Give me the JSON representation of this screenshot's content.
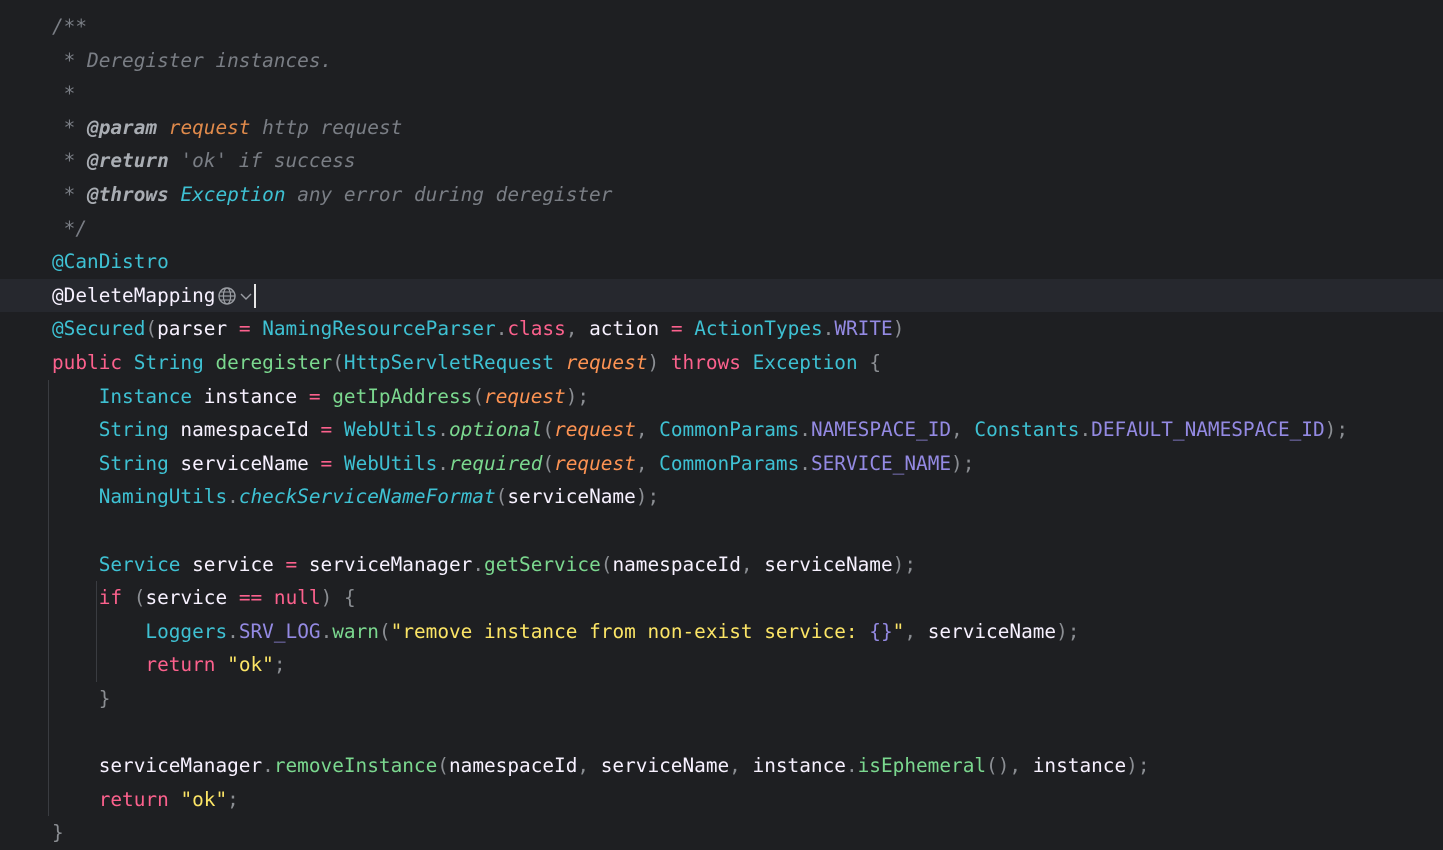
{
  "editor": {
    "language": "Java",
    "lines": [
      [
        [
          "comment",
          "/**"
        ]
      ],
      [
        [
          "comment",
          " * Deregister instances."
        ]
      ],
      [
        [
          "comment",
          " *"
        ]
      ],
      [
        [
          "comment",
          " * "
        ],
        [
          "doctag",
          "@param"
        ],
        [
          "comment",
          " "
        ],
        [
          "docparam",
          "request"
        ],
        [
          "comment",
          " http request"
        ]
      ],
      [
        [
          "comment",
          " * "
        ],
        [
          "doctag",
          "@return"
        ],
        [
          "comment",
          " 'ok' if success"
        ]
      ],
      [
        [
          "comment",
          " * "
        ],
        [
          "doctag",
          "@throws"
        ],
        [
          "comment",
          " "
        ],
        [
          "doccls",
          "Exception"
        ],
        [
          "comment",
          " any error during deregister"
        ]
      ],
      [
        [
          "comment",
          " */"
        ]
      ],
      [
        [
          "annotation",
          "@CanDistro"
        ]
      ],
      [
        [
          "plain",
          "@DeleteMapping"
        ]
      ],
      [
        [
          "annotation",
          "@Secured"
        ],
        [
          "punc",
          "("
        ],
        [
          "plain",
          "parser "
        ],
        [
          "op",
          "="
        ],
        [
          "plain",
          " "
        ],
        [
          "type",
          "NamingResourceParser"
        ],
        [
          "punc",
          "."
        ],
        [
          "kw",
          "class"
        ],
        [
          "punc",
          ", "
        ],
        [
          "plain",
          "action "
        ],
        [
          "op",
          "="
        ],
        [
          "plain",
          " "
        ],
        [
          "type",
          "ActionTypes"
        ],
        [
          "punc",
          "."
        ],
        [
          "const",
          "WRITE"
        ],
        [
          "punc",
          ")"
        ]
      ],
      [
        [
          "kw",
          "public"
        ],
        [
          "plain",
          " "
        ],
        [
          "type",
          "String"
        ],
        [
          "plain",
          " "
        ],
        [
          "fn",
          "deregister"
        ],
        [
          "punc",
          "("
        ],
        [
          "type",
          "HttpServletRequest"
        ],
        [
          "plain",
          " "
        ],
        [
          "param",
          "request"
        ],
        [
          "punc",
          ")"
        ],
        [
          "plain",
          " "
        ],
        [
          "kw",
          "throws"
        ],
        [
          "plain",
          " "
        ],
        [
          "type",
          "Exception"
        ],
        [
          "plain",
          " "
        ],
        [
          "punc",
          "{"
        ]
      ],
      [
        [
          "plain",
          "    "
        ],
        [
          "type",
          "Instance"
        ],
        [
          "plain",
          " instance "
        ],
        [
          "op",
          "="
        ],
        [
          "plain",
          " "
        ],
        [
          "fn",
          "getIpAddress"
        ],
        [
          "punc",
          "("
        ],
        [
          "param",
          "request"
        ],
        [
          "punc",
          ");"
        ]
      ],
      [
        [
          "plain",
          "    "
        ],
        [
          "type",
          "String"
        ],
        [
          "plain",
          " namespaceId "
        ],
        [
          "op",
          "="
        ],
        [
          "plain",
          " "
        ],
        [
          "type",
          "WebUtils"
        ],
        [
          "punc",
          "."
        ],
        [
          "fni",
          "optional"
        ],
        [
          "punc",
          "("
        ],
        [
          "param",
          "request"
        ],
        [
          "punc",
          ", "
        ],
        [
          "type",
          "CommonParams"
        ],
        [
          "punc",
          "."
        ],
        [
          "const",
          "NAMESPACE_ID"
        ],
        [
          "punc",
          ", "
        ],
        [
          "type",
          "Constants"
        ],
        [
          "punc",
          "."
        ],
        [
          "const",
          "DEFAULT_NAMESPACE_ID"
        ],
        [
          "punc",
          ");"
        ]
      ],
      [
        [
          "plain",
          "    "
        ],
        [
          "type",
          "String"
        ],
        [
          "plain",
          " serviceName "
        ],
        [
          "op",
          "="
        ],
        [
          "plain",
          " "
        ],
        [
          "type",
          "WebUtils"
        ],
        [
          "punc",
          "."
        ],
        [
          "fni",
          "required"
        ],
        [
          "punc",
          "("
        ],
        [
          "param",
          "request"
        ],
        [
          "punc",
          ", "
        ],
        [
          "type",
          "CommonParams"
        ],
        [
          "punc",
          "."
        ],
        [
          "const",
          "SERVICE_NAME"
        ],
        [
          "punc",
          ");"
        ]
      ],
      [
        [
          "plain",
          "    "
        ],
        [
          "type",
          "NamingUtils"
        ],
        [
          "punc",
          "."
        ],
        [
          "fnsi",
          "checkServiceNameFormat"
        ],
        [
          "punc",
          "("
        ],
        [
          "plain",
          "serviceName"
        ],
        [
          "punc",
          ");"
        ]
      ],
      [],
      [
        [
          "plain",
          "    "
        ],
        [
          "type",
          "Service"
        ],
        [
          "plain",
          " service "
        ],
        [
          "op",
          "="
        ],
        [
          "plain",
          " serviceManager"
        ],
        [
          "punc",
          "."
        ],
        [
          "fn",
          "getService"
        ],
        [
          "punc",
          "("
        ],
        [
          "plain",
          "namespaceId"
        ],
        [
          "punc",
          ", "
        ],
        [
          "plain",
          "serviceName"
        ],
        [
          "punc",
          ");"
        ]
      ],
      [
        [
          "plain",
          "    "
        ],
        [
          "kw",
          "if"
        ],
        [
          "plain",
          " "
        ],
        [
          "punc",
          "("
        ],
        [
          "plain",
          "service "
        ],
        [
          "op",
          "=="
        ],
        [
          "plain",
          " "
        ],
        [
          "kw",
          "null"
        ],
        [
          "punc",
          ")"
        ],
        [
          "plain",
          " "
        ],
        [
          "punc",
          "{"
        ]
      ],
      [
        [
          "plain",
          "        "
        ],
        [
          "type",
          "Loggers"
        ],
        [
          "punc",
          "."
        ],
        [
          "const",
          "SRV_LOG"
        ],
        [
          "punc",
          "."
        ],
        [
          "fn",
          "warn"
        ],
        [
          "punc",
          "("
        ],
        [
          "str",
          "\"remove instance from non-exist service: "
        ],
        [
          "const",
          "{}"
        ],
        [
          "str",
          "\""
        ],
        [
          "punc",
          ", "
        ],
        [
          "plain",
          "serviceName"
        ],
        [
          "punc",
          ");"
        ]
      ],
      [
        [
          "plain",
          "        "
        ],
        [
          "kw",
          "return"
        ],
        [
          "plain",
          " "
        ],
        [
          "str",
          "\"ok\""
        ],
        [
          "punc",
          ";"
        ]
      ],
      [
        [
          "plain",
          "    "
        ],
        [
          "punc",
          "}"
        ]
      ],
      [],
      [
        [
          "plain",
          "    serviceManager"
        ],
        [
          "punc",
          "."
        ],
        [
          "fn",
          "removeInstance"
        ],
        [
          "punc",
          "("
        ],
        [
          "plain",
          "namespaceId"
        ],
        [
          "punc",
          ", "
        ],
        [
          "plain",
          "serviceName"
        ],
        [
          "punc",
          ", "
        ],
        [
          "plain",
          "instance"
        ],
        [
          "punc",
          "."
        ],
        [
          "fn",
          "isEphemeral"
        ],
        [
          "punc",
          "(), "
        ],
        [
          "plain",
          "instance"
        ],
        [
          "punc",
          ");"
        ]
      ],
      [
        [
          "plain",
          "    "
        ],
        [
          "kw",
          "return"
        ],
        [
          "plain",
          " "
        ],
        [
          "str",
          "\"ok\""
        ],
        [
          "punc",
          ";"
        ]
      ],
      [
        [
          "punc",
          "}"
        ]
      ]
    ],
    "current_line": 8,
    "inlay_icons": [
      {
        "line": 8,
        "icon": "globe-icon"
      },
      {
        "line": 8,
        "icon": "chevron-down-icon"
      }
    ],
    "colors": {
      "background": "#1e1f22",
      "current_line": "#26282e",
      "keyword": "#fc618d",
      "type": "#3ec1d3",
      "function": "#7bd88f",
      "parameter": "#fd9353",
      "constant": "#948ae3",
      "string": "#fce566",
      "comment": "#7a7e85"
    }
  }
}
